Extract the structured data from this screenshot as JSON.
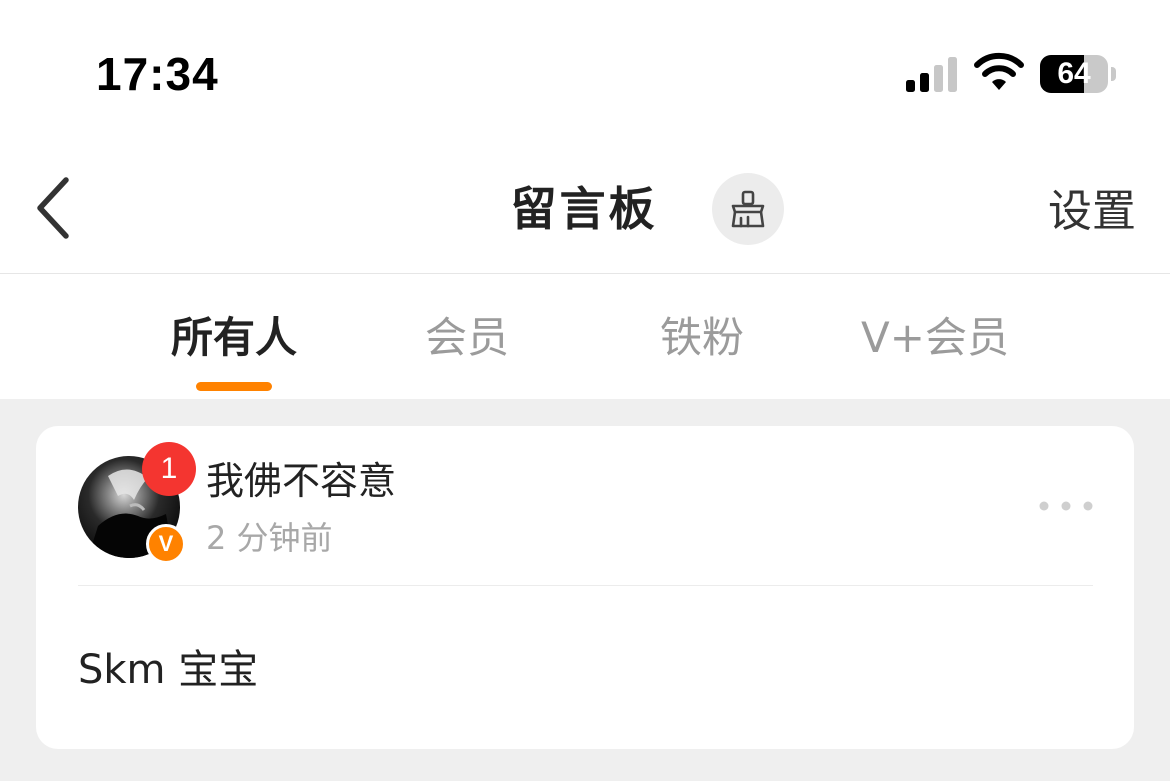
{
  "status_bar": {
    "time": "17:34",
    "battery_level": "64",
    "icons": [
      "signal-icon",
      "wifi-icon",
      "battery-icon"
    ]
  },
  "nav": {
    "title": "留言板",
    "settings_label": "设置",
    "icons": {
      "back": "chevron-left-icon",
      "clean": "broom-icon"
    }
  },
  "tabs": [
    {
      "label": "所有人",
      "active": true
    },
    {
      "label": "会员",
      "active": false
    },
    {
      "label": "铁粉",
      "active": false
    },
    {
      "label": "V+会员",
      "active": false
    }
  ],
  "messages": [
    {
      "username": "我佛不容意",
      "time": "2 分钟前",
      "unread_count": "1",
      "verified_mark": "V",
      "content": "Skm 宝宝"
    }
  ],
  "colors": {
    "accent": "#ff8200",
    "badge_red": "#f43530",
    "page_bg": "#efefef",
    "muted_text": "#9b9b9b"
  }
}
